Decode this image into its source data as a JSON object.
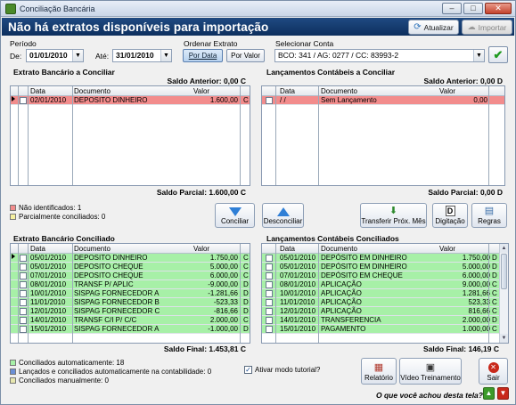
{
  "window": {
    "title": "Conciliação Bancária"
  },
  "banner": {
    "heading": "Não há extratos disponíveis para importação",
    "atualizar": "Atualizar",
    "importar": "Importar"
  },
  "filters": {
    "periodo_label": "Período",
    "de_label": "De:",
    "de_value": "01/01/2010",
    "ate_label": "Até:",
    "ate_value": "31/01/2010",
    "ordenar_label": "Ordenar Extrato",
    "por_data": "Por Data",
    "por_valor": "Por Valor",
    "conta_label": "Selecionar Conta",
    "conta_value": "BCO: 341 / AG: 0277 / CC: 83993-2"
  },
  "extrato_conciliar": {
    "title": "Extrato Bancário a Conciliar",
    "saldo_anterior": "Saldo Anterior: 0,00 C",
    "saldo_parcial": "Saldo Parcial: 1.600,00 C",
    "headers": {
      "data": "Data",
      "documento": "Documento",
      "valor": "Valor"
    },
    "rows": [
      {
        "data": "02/01/2010",
        "doc": "DEPOSITO DINHEIRO",
        "valor": "1.600,00",
        "dc": "C"
      }
    ]
  },
  "lanc_conciliar": {
    "title": "Lançamentos Contábeis a Conciliar",
    "saldo_anterior": "Saldo Anterior: 0,00 D",
    "saldo_parcial": "Saldo Parcial: 0,00 D",
    "headers": {
      "data": "Data",
      "documento": "Documento",
      "valor": "Valor"
    },
    "rows": [
      {
        "data": "/  /",
        "doc": "Sem Lançamento",
        "valor": "0,00",
        "dc": ""
      }
    ]
  },
  "legend_top": {
    "nao_ident": "Não identificados: 1",
    "parcial": "Parcialmente conciliados: 0"
  },
  "actions": {
    "conciliar": "Conciliar",
    "desconciliar": "Desconciliar",
    "transferir": "Transferir Próx. Mês",
    "digitacao": "Digitação",
    "regras": "Regras",
    "digitacao_icon_letter": "D"
  },
  "extrato_conciliado": {
    "title": "Extrato Bancário Conciliado",
    "saldo_final": "Saldo Final: 1.453,81 C",
    "headers": {
      "data": "Data",
      "documento": "Documento",
      "valor": "Valor"
    },
    "rows": [
      {
        "data": "05/01/2010",
        "doc": "DEPOSITO DINHEIRO",
        "valor": "1.750,00",
        "dc": "C"
      },
      {
        "data": "05/01/2010",
        "doc": "DEPOSITO CHEQUE",
        "valor": "5.000,00",
        "dc": "C"
      },
      {
        "data": "07/01/2010",
        "doc": "DEPOSITO CHEQUE",
        "valor": "6.000,00",
        "dc": "C"
      },
      {
        "data": "08/01/2010",
        "doc": "TRANSF P/ APLIC",
        "valor": "-9.000,00",
        "dc": "D"
      },
      {
        "data": "10/01/2010",
        "doc": "SISPAG FORNECEDOR A",
        "valor": "-1.281,66",
        "dc": "D"
      },
      {
        "data": "11/01/2010",
        "doc": "SISPAG FORNECEDOR B",
        "valor": "-523,33",
        "dc": "D"
      },
      {
        "data": "12/01/2010",
        "doc": "SISPAG FORNECEDOR C",
        "valor": "-816,66",
        "dc": "D"
      },
      {
        "data": "14/01/2010",
        "doc": "TRANSF C/I P/ C/C",
        "valor": "2.000,00",
        "dc": "C"
      },
      {
        "data": "15/01/2010",
        "doc": "SISPAG FORNECEDOR A",
        "valor": "-1.000,00",
        "dc": "D"
      }
    ]
  },
  "lanc_conciliados": {
    "title": "Lançamentos Contábeis Conciliados",
    "saldo_final": "Saldo Final: 146,19 C",
    "headers": {
      "data": "Data",
      "documento": "Documento",
      "valor": "Valor"
    },
    "rows": [
      {
        "data": "05/01/2010",
        "doc": "DEPÓSITO EM DINHEIRO",
        "valor": "1.750,00",
        "dc": "D"
      },
      {
        "data": "05/01/2010",
        "doc": "DEPÓSITO EM DINHEIRO",
        "valor": "5.000,00",
        "dc": "D"
      },
      {
        "data": "07/01/2010",
        "doc": "DEPÓSITO EM CHEQUE",
        "valor": "6.000,00",
        "dc": "D"
      },
      {
        "data": "08/01/2010",
        "doc": "APLICAÇÃO",
        "valor": "9.000,00",
        "dc": "C"
      },
      {
        "data": "10/01/2010",
        "doc": "APLICAÇÃO",
        "valor": "1.281,66",
        "dc": "C"
      },
      {
        "data": "11/01/2010",
        "doc": "APLICAÇÃO",
        "valor": "523,33",
        "dc": "C"
      },
      {
        "data": "12/01/2010",
        "doc": "APLICAÇÃO",
        "valor": "816,66",
        "dc": "C"
      },
      {
        "data": "14/01/2010",
        "doc": "TRANSFERENCIA",
        "valor": "2.000,00",
        "dc": "D"
      },
      {
        "data": "15/01/2010",
        "doc": "PAGAMENTO",
        "valor": "1.000,00",
        "dc": "C"
      }
    ]
  },
  "legend_bottom": {
    "auto": "Conciliados automaticamente: 18",
    "lanc_auto": "Lançados e conciliados automaticamente na contabilidade: 0",
    "manual": "Conciliados manualmente: 0"
  },
  "footer": {
    "tutorial": "Ativar modo tutorial?",
    "relatorio": "Relatório",
    "video": "Vídeo Treinamento",
    "sair": "Sair",
    "feedback": "O que você achou desta tela?"
  },
  "colors": {
    "banner": "#0d2f5e",
    "red_row": "#f28c8c",
    "green_row": "#a7f0a7",
    "accent_blue": "#2f7fd6"
  }
}
